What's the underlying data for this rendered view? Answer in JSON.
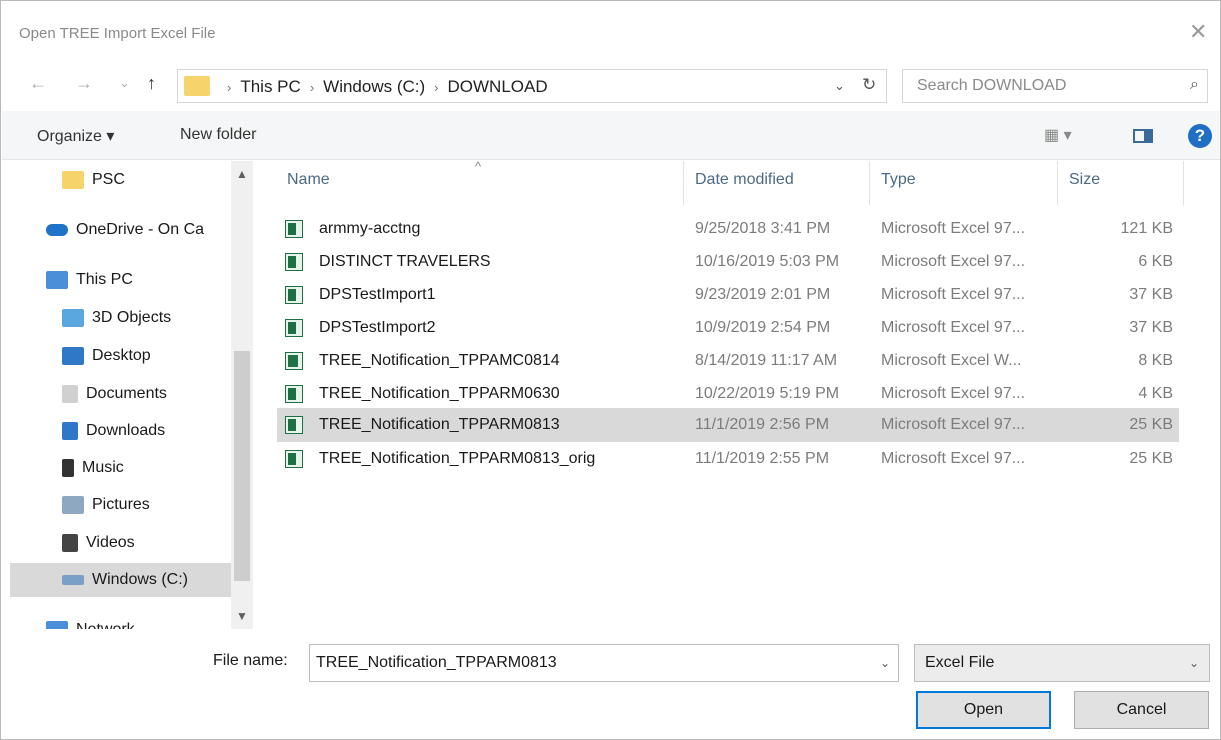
{
  "window": {
    "title": "Open TREE Import Excel File",
    "close_glyph": "✕"
  },
  "nav": {
    "back_glyph": "←",
    "forward_glyph": "→",
    "recent_glyph": "⌄",
    "up_glyph": "↑",
    "breadcrumbs": [
      "This PC",
      "Windows (C:)",
      "DOWNLOAD"
    ],
    "search_placeholder": "Search DOWNLOAD"
  },
  "toolbar": {
    "organize": "Organize ▾",
    "new_folder": "New folder",
    "help": "?"
  },
  "navpane": {
    "items": [
      {
        "label": "PSC",
        "icon": "folder-icon",
        "color": "#f6d36b"
      },
      {
        "label": "OneDrive - On Ca",
        "icon": "onedrive-icon",
        "color": "#1e73c8"
      },
      {
        "label": "This PC",
        "icon": "computer-icon",
        "color": "#4a8fd8"
      },
      {
        "label": "3D Objects",
        "icon": "3d-objects-icon",
        "color": "#5aa7e0"
      },
      {
        "label": "Desktop",
        "icon": "desktop-icon",
        "color": "#2f78c7"
      },
      {
        "label": "Documents",
        "icon": "documents-icon",
        "color": "#c9c9c9"
      },
      {
        "label": "Downloads",
        "icon": "downloads-icon",
        "color": "#2f78c7"
      },
      {
        "label": "Music",
        "icon": "music-icon",
        "color": "#333333"
      },
      {
        "label": "Pictures",
        "icon": "pictures-icon",
        "color": "#8fa8c2"
      },
      {
        "label": "Videos",
        "icon": "videos-icon",
        "color": "#444444"
      },
      {
        "label": "Windows (C:)",
        "icon": "drive-icon",
        "color": "#7aa0c8"
      },
      {
        "label": "Network",
        "icon": "network-icon",
        "color": "#4a8fd8"
      }
    ],
    "selected": "Windows (C:)"
  },
  "columns": {
    "name": "Name",
    "date": "Date modified",
    "type": "Type",
    "size": "Size"
  },
  "files": [
    {
      "name": "armmy-acctng",
      "date": "9/25/2018 3:41 PM",
      "type": "Microsoft Excel 97...",
      "size": "121 KB"
    },
    {
      "name": "DISTINCT TRAVELERS",
      "date": "10/16/2019 5:03 PM",
      "type": "Microsoft Excel 97...",
      "size": "6 KB"
    },
    {
      "name": "DPSTestImport1",
      "date": "9/23/2019 2:01 PM",
      "type": "Microsoft Excel 97...",
      "size": "37 KB"
    },
    {
      "name": "DPSTestImport2",
      "date": "10/9/2019 2:54 PM",
      "type": "Microsoft Excel 97...",
      "size": "37 KB"
    },
    {
      "name": "TREE_Notification_TPPAMC0814",
      "date": "8/14/2019 11:17 AM",
      "type": "Microsoft Excel W...",
      "size": "8 KB"
    },
    {
      "name": "TREE_Notification_TPPARM0630",
      "date": "10/22/2019 5:19 PM",
      "type": "Microsoft Excel 97...",
      "size": "4 KB"
    },
    {
      "name": "TREE_Notification_TPPARM0813",
      "date": "11/1/2019 2:56 PM",
      "type": "Microsoft Excel 97...",
      "size": "25 KB"
    },
    {
      "name": "TREE_Notification_TPPARM0813_orig",
      "date": "11/1/2019 2:55 PM",
      "type": "Microsoft Excel 97...",
      "size": "25 KB"
    }
  ],
  "selected_file": "TREE_Notification_TPPARM0813",
  "footer": {
    "file_name_label": "File name:",
    "file_name_value": "TREE_Notification_TPPARM0813",
    "file_type": "Excel File",
    "open": "Open",
    "cancel": "Cancel"
  }
}
